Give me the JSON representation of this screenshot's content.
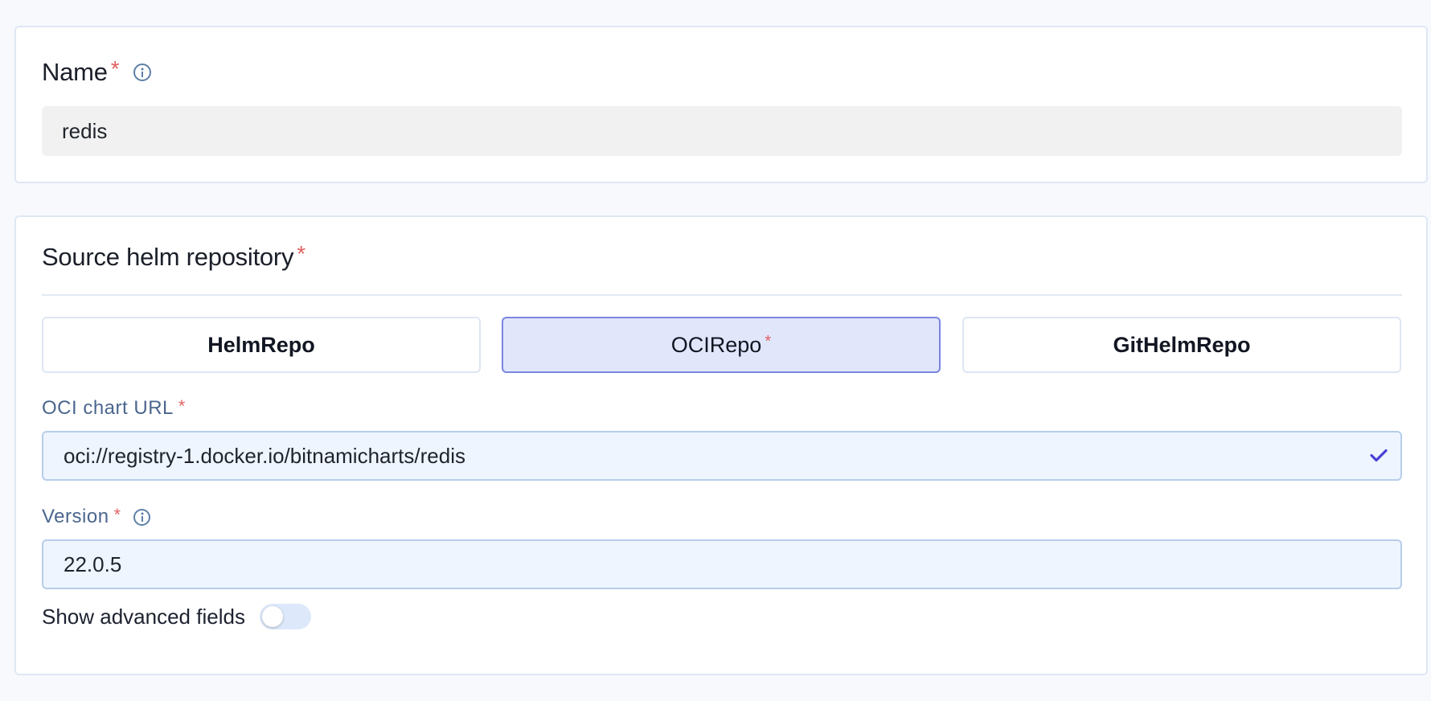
{
  "name_section": {
    "title": "Name",
    "required_marker": "*",
    "info_icon": "info-icon",
    "value": "redis"
  },
  "source_section": {
    "title": "Source helm repository",
    "required_marker": "*",
    "tabs": [
      {
        "label": "HelmRepo",
        "selected": false
      },
      {
        "label": "OCIRepo",
        "selected": true,
        "required_marker": "*"
      },
      {
        "label": "GitHelmRepo",
        "selected": false
      }
    ],
    "oci_url": {
      "label": "OCI chart URL",
      "required_marker": "*",
      "value": "oci://registry-1.docker.io/bitnamicharts/redis",
      "status_icon": "check-icon"
    },
    "version": {
      "label": "Version",
      "required_marker": "*",
      "info_icon": "info-icon",
      "value": "22.0.5"
    },
    "advanced": {
      "label": "Show advanced fields",
      "enabled": false
    }
  },
  "colors": {
    "page_bg": "#f7f9fd",
    "required": "#e0605f",
    "selected_tab_bg": "#e1e6fb",
    "selected_tab_border": "#7a86df",
    "check": "#4a3fd6",
    "label": "#4b668e"
  }
}
